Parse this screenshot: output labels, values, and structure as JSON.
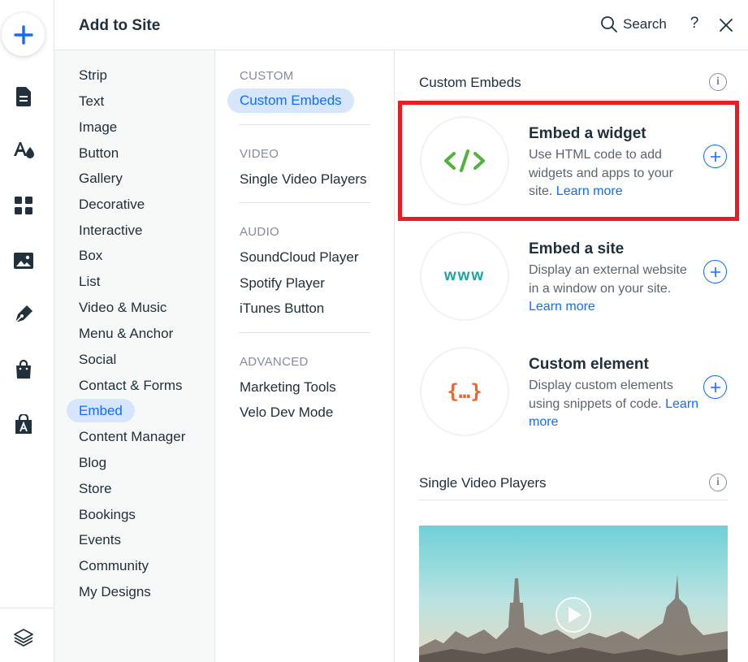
{
  "header": {
    "title": "Add to Site",
    "search_label": "Search",
    "help_label": "?"
  },
  "rail": {
    "icons": [
      "add-icon",
      "pages-icon",
      "design-icon",
      "apps-icon",
      "media-icon",
      "blog-icon",
      "store-icon",
      "app-market-icon",
      "layers-icon"
    ]
  },
  "categories": {
    "items": [
      "Strip",
      "Text",
      "Image",
      "Button",
      "Gallery",
      "Decorative",
      "Interactive",
      "Box",
      "List",
      "Video & Music",
      "Menu & Anchor",
      "Social",
      "Contact & Forms",
      "Embed",
      "Content Manager",
      "Blog",
      "Store",
      "Bookings",
      "Events",
      "Community",
      "My Designs"
    ],
    "active": "Embed"
  },
  "subcategories": {
    "custom_head": "CUSTOM",
    "custom_items": [
      "Custom Embeds"
    ],
    "video_head": "VIDEO",
    "video_items": [
      "Single Video Players"
    ],
    "audio_head": "AUDIO",
    "audio_items": [
      "SoundCloud Player",
      "Spotify Player",
      "iTunes Button"
    ],
    "advanced_head": "ADVANCED",
    "advanced_items": [
      "Marketing Tools",
      "Velo Dev Mode"
    ]
  },
  "main": {
    "section_title": "Custom Embeds",
    "info_label": "i",
    "cards": [
      {
        "title": "Embed a widget",
        "desc": "Use HTML code to add widgets and apps to your site.",
        "link": "Learn more",
        "thumb": "</>",
        "thumb_color": "#52b33c"
      },
      {
        "title": "Embed a site",
        "desc": "Display an external website in a window on your site.",
        "link": "Learn more",
        "thumb": "www",
        "thumb_color": "#1aa4a4"
      },
      {
        "title": "Custom element",
        "desc": "Display custom elements using snippets of code.",
        "link": "Learn more",
        "thumb": "{...}",
        "thumb_color": "#f2622b"
      }
    ],
    "video_section_title": "Single Video Players"
  },
  "colors": {
    "accent": "#116dff",
    "active_bg": "#d6e6fe",
    "highlight": "#e71d23"
  }
}
